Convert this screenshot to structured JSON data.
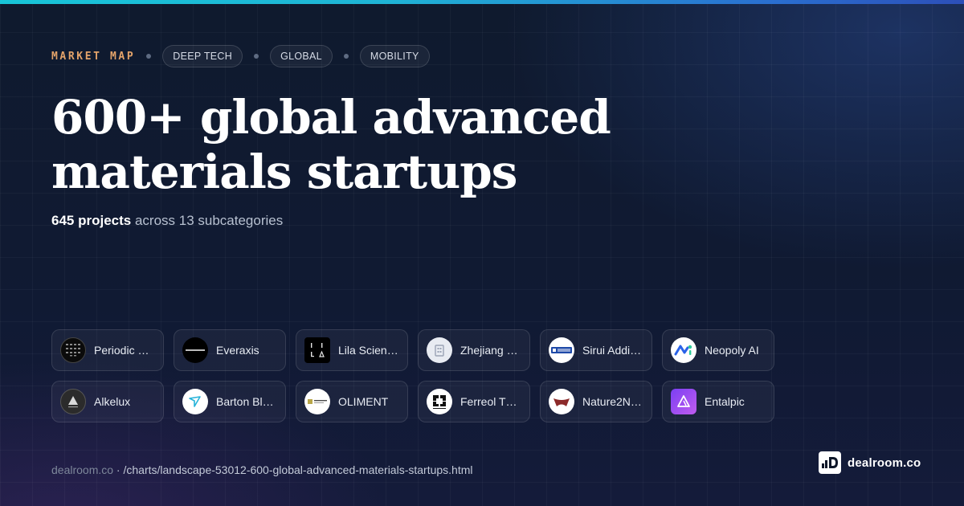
{
  "header": {
    "kicker": "MARKET MAP",
    "tags": [
      "DEEP TECH",
      "GLOBAL",
      "MOBILITY"
    ]
  },
  "title": "600+ global advanced materials startups",
  "subtitle": {
    "count": "645 projects",
    "rest": "across 13 subcategories"
  },
  "companies": [
    {
      "name": "Periodic …",
      "icon": "periodic-logo-icon"
    },
    {
      "name": "Everaxis",
      "icon": "everaxis-logo-icon"
    },
    {
      "name": "Lila Scien…",
      "icon": "lila-logo-icon"
    },
    {
      "name": "Zhejiang …",
      "icon": "zhejiang-logo-icon"
    },
    {
      "name": "Sirui Addi…",
      "icon": "sirui-logo-icon"
    },
    {
      "name": "Neopoly AI",
      "icon": "neopoly-logo-icon"
    },
    {
      "name": "Alkelux",
      "icon": "alkelux-logo-icon"
    },
    {
      "name": "Barton Bl…",
      "icon": "barton-logo-icon"
    },
    {
      "name": "OLIMENT",
      "icon": "oliment-logo-icon"
    },
    {
      "name": "Ferreol T…",
      "icon": "ferreol-logo-icon"
    },
    {
      "name": "Nature2N…",
      "icon": "nature2n-logo-icon"
    },
    {
      "name": "Entalpic",
      "icon": "entalpic-logo-icon"
    }
  ],
  "footer": {
    "domain": "dealroom.co",
    "separator": " · ",
    "path": "/charts/landscape-53012-600-global-advanced-materials-startups.html"
  },
  "brand": {
    "name": "dealroom.co"
  },
  "colors": {
    "accent": "#e3a36a",
    "background": "#0e1729",
    "topbar_start": "#18c5d8",
    "topbar_end": "#2c4fb8"
  }
}
